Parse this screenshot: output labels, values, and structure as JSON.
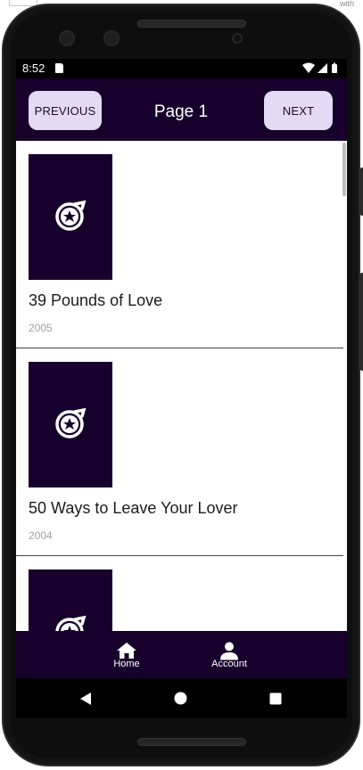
{
  "corner_text": "with",
  "status_bar": {
    "time": "8:52"
  },
  "app_bar": {
    "previous_label": "PREVIOUS",
    "page_title": "Page 1",
    "next_label": "NEXT"
  },
  "movies": [
    {
      "title": "39 Pounds of Love",
      "year": "2005"
    },
    {
      "title": "50 Ways to Leave Your Lover",
      "year": "2004"
    },
    {
      "title": "",
      "year": ""
    }
  ],
  "bottom_nav": {
    "home_label": "Home",
    "account_label": "Account"
  },
  "colors": {
    "app_bar_bg": "#17002b",
    "button_bg": "#e5d9f5",
    "year_text": "#a0a0a0"
  },
  "icons": [
    "sd-card-icon",
    "wifi-icon",
    "cell-signal-icon",
    "battery-icon",
    "film-reel-icon",
    "home-icon",
    "account-icon",
    "back-icon",
    "home-circle-icon",
    "recents-icon"
  ]
}
